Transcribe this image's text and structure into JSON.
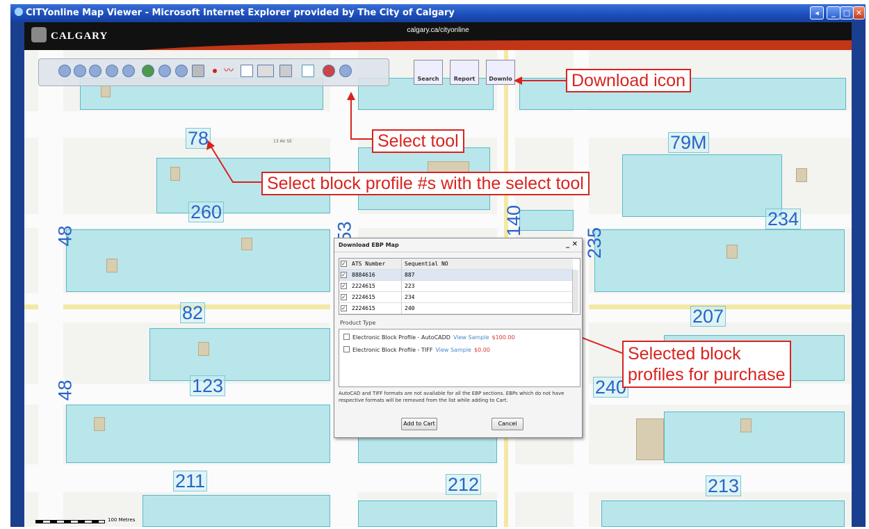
{
  "window": {
    "title": "CITYonline Map Viewer - Microsoft Internet Explorer provided by The City of Calgary",
    "controls": [
      "◂",
      "_",
      "□",
      "✕"
    ]
  },
  "banner": {
    "logo_text": "CALGARY",
    "url": "calgary.ca/cityonline"
  },
  "toolbar": {
    "tools": [
      "zoom-in-icon",
      "zoom-out-icon",
      "pan-hand-icon",
      "back-icon",
      "forward-icon",
      "globe-icon",
      "search-map-icon",
      "refresh-icon",
      "print-icon",
      "point-icon",
      "line-icon",
      "envelope-icon",
      "ruler-icon",
      "pencil-icon",
      "select-tool-icon",
      "measure-icon",
      "help-icon"
    ],
    "search_label": "Search",
    "report_label": "Report",
    "download_label": "Downlo"
  },
  "map": {
    "block_numbers": [
      "78",
      "260",
      "82",
      "123",
      "211",
      "212",
      "213",
      "79M",
      "234",
      "207",
      "240"
    ],
    "vertical_numbers": [
      "48",
      "48",
      "53",
      "140",
      "235"
    ],
    "street_text": "13 AV SE",
    "scale_label": "100 Metres"
  },
  "annotations": {
    "download_icon": "Download icon",
    "select_tool": "Select tool",
    "select_block": "Select block profile #s with the select tool",
    "selected_line1": "Selected block",
    "selected_line2": "profiles for purchase"
  },
  "dialog": {
    "title": "Download EBP Map",
    "close": "_ ✕",
    "col_ats": "ATS Number",
    "col_seq": "Sequential NO",
    "rows": [
      {
        "ats": "8884616",
        "seq": "887"
      },
      {
        "ats": "2224615",
        "seq": "223"
      },
      {
        "ats": "2224615",
        "seq": "234"
      },
      {
        "ats": "2224615",
        "seq": "240"
      }
    ],
    "product_type_label": "Product Type",
    "products": [
      {
        "name": "Electronic Block Profile - AutoCADD",
        "link": "View Sample",
        "price": "$100.00"
      },
      {
        "name": "Electronic Block Profile - TIFF",
        "link": "View Sample",
        "price": "$0.00"
      }
    ],
    "note": "AutoCAD and TIFF formats are not available for all the EBP sections. EBPs which do not have respective formats will be removed from the list while adding to Cart.",
    "add_button": "Add to Cart",
    "cancel_button": "Cancel"
  }
}
